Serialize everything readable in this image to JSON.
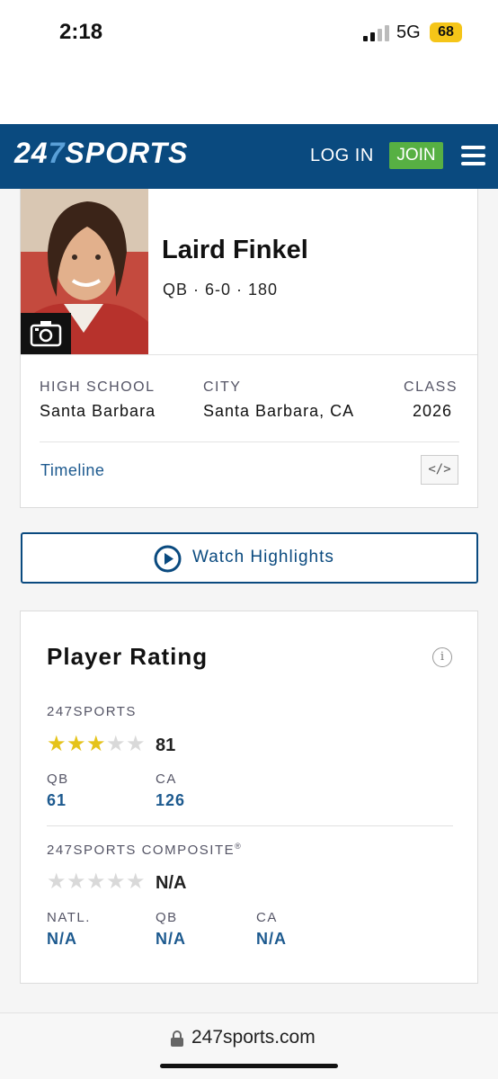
{
  "status_bar": {
    "time": "2:18",
    "network": "5G",
    "battery": "68"
  },
  "header": {
    "logo_prefix": "24",
    "logo_seven": "7",
    "logo_suffix": "SPORTS",
    "login_label": "LOG IN",
    "join_label": "JOIN"
  },
  "player": {
    "name": "Laird Finkel",
    "meta": "QB · 6-0 · 180"
  },
  "info": {
    "high_school_label": "HIGH SCHOOL",
    "high_school": "Santa Barbara",
    "city_label": "CITY",
    "city": "Santa Barbara, CA",
    "class_label": "CLASS",
    "class": "2026"
  },
  "timeline_label": "Timeline",
  "embed_label": "</>",
  "highlights_label": "Watch Highlights",
  "rating": {
    "title": "Player Rating",
    "info_glyph": "i",
    "sports247": {
      "label": "247SPORTS",
      "stars_filled": 3,
      "stars_total": 5,
      "score": "81",
      "sub": [
        {
          "label": "QB",
          "value": "61"
        },
        {
          "label": "CA",
          "value": "126"
        }
      ]
    },
    "composite": {
      "label": "247SPORTS COMPOSITE",
      "reg_mark": "®",
      "stars_filled": 0,
      "stars_total": 5,
      "score": "N/A",
      "sub": [
        {
          "label": "NATL.",
          "value": "N/A"
        },
        {
          "label": "QB",
          "value": "N/A"
        },
        {
          "label": "CA",
          "value": "N/A"
        }
      ]
    }
  },
  "url_bar": {
    "url": "247sports.com"
  },
  "icons": {
    "camera": "camera-icon",
    "play": "play-circle-icon",
    "lock": "lock-icon",
    "menu": "hamburger-menu-icon",
    "info": "info-icon",
    "star": "star-icon"
  },
  "colors": {
    "brand_blue": "#0a4a7f",
    "join_green": "#57b043",
    "star_gold": "#e5c31b",
    "link_blue": "#1d5a8f"
  }
}
